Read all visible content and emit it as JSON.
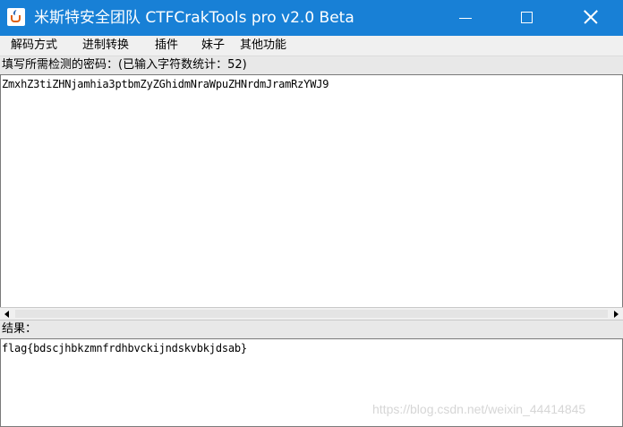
{
  "window": {
    "title": "米斯特安全团队 CTFCrakTools pro v2.0 Beta",
    "title_bar_color": "#1880d6"
  },
  "menu": {
    "items": [
      {
        "label": "解码方式"
      },
      {
        "label": "进制转换"
      },
      {
        "label": "插件"
      },
      {
        "label": "妹子"
      },
      {
        "label": "其他功能"
      }
    ]
  },
  "input_section": {
    "label": "填写所需检测的密码：(已输入字符数统计：52)",
    "value": "ZmxhZ3tiZHNjamhia3ptbmZyZGhidmNraWpuZHNrdmJramRzYWJ9"
  },
  "result_section": {
    "label": "结果：",
    "value": "flag{bdscjhbkzmnfrdhbvckijndskvbkjdsab}"
  },
  "watermark": "https://blog.csdn.net/weixin_44414845"
}
